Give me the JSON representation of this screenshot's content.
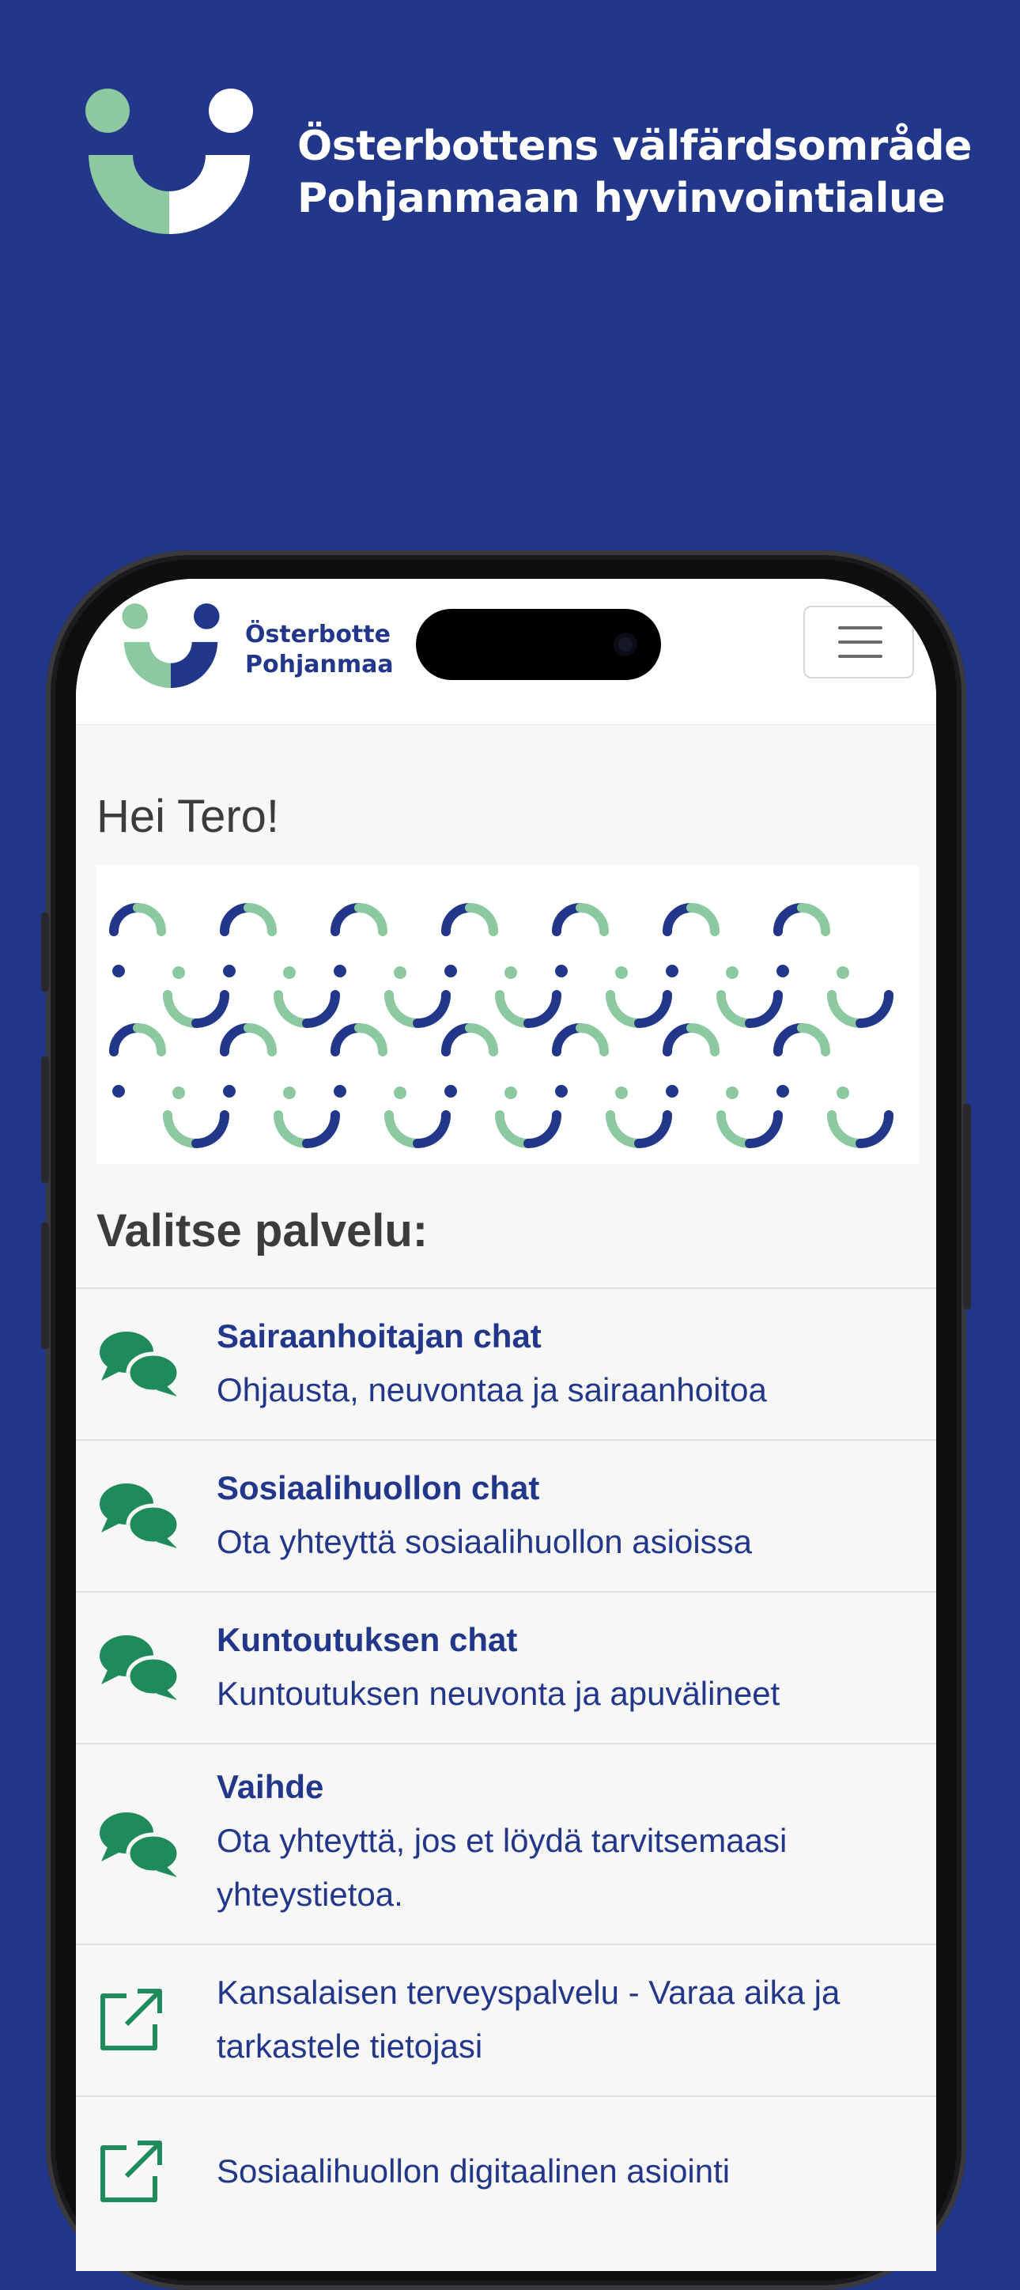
{
  "brand": {
    "line1": "Österbottens välfärdsområde",
    "line2": "Pohjanmaan hyvinvointialue",
    "nav_line1": "Österbotte",
    "nav_line2": "Pohjanmaa"
  },
  "colors": {
    "background": "#22378a",
    "brand_blue": "#22378a",
    "brand_green": "#8cc9a0",
    "chat_icon_green": "#1f8a5b"
  },
  "greeting": "Hei Tero!",
  "section_title": "Valitse palvelu:",
  "services": [
    {
      "icon": "chat-bubbles-icon",
      "title": "Sairaanhoitajan chat",
      "desc": "Ohjausta, neuvontaa ja sairaanhoitoa"
    },
    {
      "icon": "chat-bubbles-icon",
      "title": "Sosiaalihuollon chat",
      "desc": "Ota yhteyttä sosiaalihuollon asioissa"
    },
    {
      "icon": "chat-bubbles-icon",
      "title": "Kuntoutuksen chat",
      "desc": "Kuntoutuksen neuvonta ja apuvälineet"
    },
    {
      "icon": "chat-bubbles-icon",
      "title": "Vaihde",
      "desc": "Ota yhteyttä, jos et löydä tarvitsemaasi yhteystietoa."
    },
    {
      "icon": "external-link-icon",
      "title": "",
      "desc": "Kansalaisen terveyspalvelu - Varaa aika ja tarkastele tietojasi"
    },
    {
      "icon": "external-link-icon",
      "title": "",
      "desc": "Sosiaalihuollon digitaalinen asiointi"
    }
  ]
}
